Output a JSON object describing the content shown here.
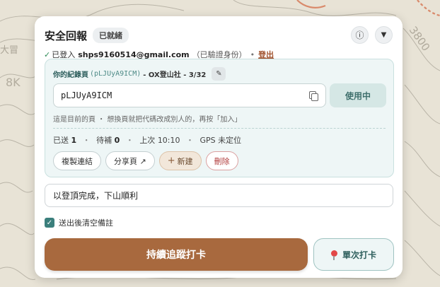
{
  "header": {
    "title": "安全回報",
    "status_badge": "已就緒",
    "info_icon": "ⓘ",
    "menu_icon": "▼"
  },
  "login": {
    "check": "✓",
    "prefix": "已登入",
    "email": "shps9160514@gmail.com",
    "verified": "（已驗證身份）",
    "separator": "•",
    "logout_label": "登出"
  },
  "record": {
    "label": "你的紀錄頁",
    "code_inline": "(pLJUyA9ICM)",
    "org_and_count": "- OX登山社 - 3/32",
    "edit_icon": "✎",
    "code_value": "pLJUyA9ICM",
    "in_use_label": "使用中",
    "hint": "這是目前的頁 ・ 想換頁就把代碼改成別人的，再按「加入」",
    "stats": {
      "sent_label": "已送",
      "sent_count": "1",
      "retry_label": "待補",
      "retry_count": "0",
      "last_label": "上次",
      "last_time": "10:10",
      "gps_status": "GPS 未定位",
      "dot": "・"
    },
    "actions": {
      "copy_link": "複製連結",
      "share_page": "分享頁 ↗",
      "new_plus": "+",
      "new_label": "新建",
      "delete_label": "刪除"
    }
  },
  "note": {
    "value": "以登頂完成，下山順利"
  },
  "clear_after_send": {
    "checked_mark": "✓",
    "label": "送出後清空備註"
  },
  "buttons": {
    "continuous_track": "持續追蹤打卡",
    "single_checkin": "單次打卡"
  },
  "map_labels": [
    "3800",
    "8K",
    "大冒"
  ],
  "colors": {
    "primary_brown": "#a8693e",
    "teal_accent": "#3b7f7c",
    "danger_red": "#b03a3a",
    "logout_link": "#a0522d"
  }
}
